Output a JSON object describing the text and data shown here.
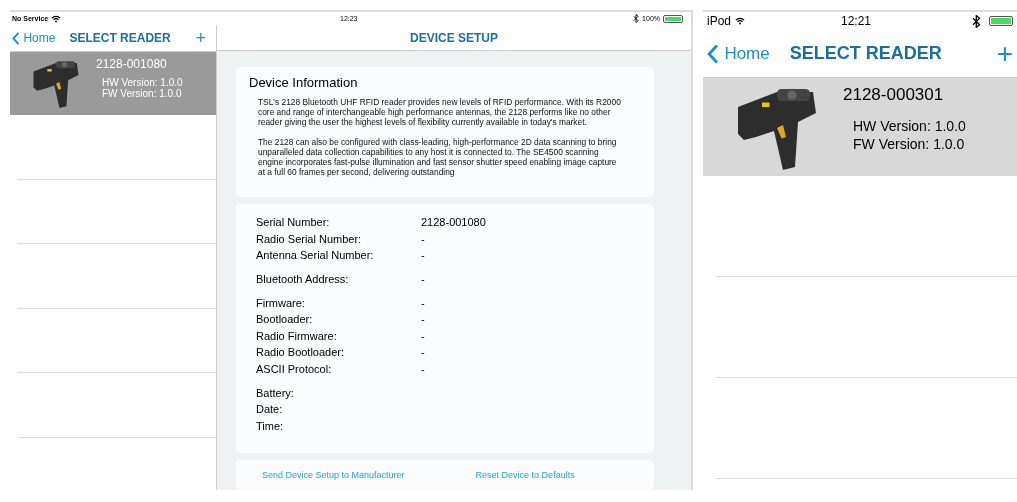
{
  "ipad": {
    "status_bar": {
      "carrier": "No Service",
      "time": "12:23",
      "battery_percent": "100%"
    },
    "sidebar": {
      "back_label": "Home",
      "title": "SELECT READER",
      "add_symbol": "+",
      "readers": [
        {
          "name": "2128-001080",
          "hw_version": "HW Version: 1.0.0",
          "fw_version": "FW Version: 1.0.0",
          "selected": true
        }
      ]
    },
    "detail": {
      "title": "DEVICE SETUP",
      "info_heading": "Device Information",
      "info_paragraphs": [
        "TSL's 2128 Bluetooth UHF RFID reader provides new levels of RFID performance.  With its R2000 core and range of interchangeable high performance antennas, the 2128 performs like no other reader giving the user the highest levels of flexibility currently available in today's market.",
        "The 2128 can also be configured with class-leading, high-performance 2D data scanning to bring unparalleled data collection capabilities to any host it is connected to. The SE4500 scanning engine incorporates fast-pulse illumination and fast sensor shutter speed enabling image capture at a full 60 frames per second, delivering outstanding"
      ],
      "field_groups": [
        [
          {
            "label": "Serial Number:",
            "value": "2128-001080"
          },
          {
            "label": "Radio Serial Number:",
            "value": "-"
          },
          {
            "label": "Antenna Serial Number:",
            "value": "-"
          }
        ],
        [
          {
            "label": "Bluetooth Address:",
            "value": "-"
          }
        ],
        [
          {
            "label": "Firmware:",
            "value": "-"
          },
          {
            "label": "Bootloader:",
            "value": "-"
          },
          {
            "label": "Radio Firmware:",
            "value": "-"
          },
          {
            "label": "Radio Bootloader:",
            "value": "-"
          },
          {
            "label": "ASCII Protocol:",
            "value": "-"
          }
        ],
        [
          {
            "label": "Battery:"
          },
          {
            "label": "Date:"
          },
          {
            "label": "Time:"
          }
        ]
      ],
      "actions": [
        "Send Device Setup to Manufacturer",
        "Reset Device to Defaults"
      ]
    }
  },
  "ipod": {
    "status_bar": {
      "carrier": "iPod",
      "time": "12:21"
    },
    "nav": {
      "back_label": "Home",
      "title": "SELECT READER",
      "add_symbol": "+"
    },
    "readers": [
      {
        "name": "2128-000301",
        "hw_version": "HW Version:  1.0.0",
        "fw_version": "FW Version:  1.0.0",
        "selected": true
      }
    ]
  }
}
